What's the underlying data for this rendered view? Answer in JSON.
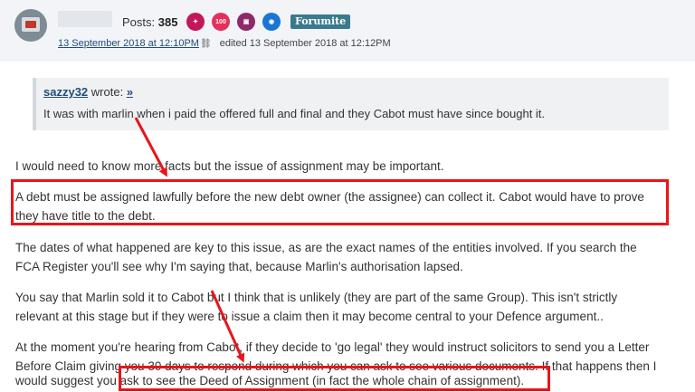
{
  "post": {
    "posts_label": "Posts:",
    "posts_count": "385",
    "badges": [
      "badge-icon",
      "100",
      "badge-icon",
      "camera-icon"
    ],
    "rank": "Forumite",
    "date": "13 September 2018 at 12:10PM",
    "edited": "edited 13 September 2018 at 12:12PM"
  },
  "quote": {
    "author": "sazzy32",
    "wrote": "wrote:",
    "jump": "»",
    "text": "It was with marlin when i paid the offered full and final and they Cabot must have since bought it."
  },
  "body": {
    "p1": "I would need to know more facts but the issue of assignment may be important.",
    "p2_line1": "A debt must be assigned lawfully before the new debt owner (the assignee) can collect it. Cabot would have to prove",
    "p2_line2": "they have title to the debt.",
    "p3_line1": "The dates of what happened are key to this issue, as are the exact names of the entities involved. If you search the",
    "p3_line2": "FCA Register you'll see why I'm saying that, because Marlin's authorisation lapsed.",
    "p4_line1": "You say that Marlin sold it to Cabot but I think that is unlikely (they are part of the same Group). This isn't strictly",
    "p4_line2": "relevant at this stage but if they were to issue a claim then it may become central to your Defence argument..",
    "p5_line1": "At the moment you're hearing from Cabot, if they decide to 'go legal' they would instruct solicitors to send you a Letter",
    "p5_line2": "Before Claim giving you 30 days to respond during which you can ask to see various documents. If that happens then I",
    "p5_line3": "would suggest you ask to see the Deed of Assignment (in fact the whole chain of assignment)."
  },
  "annotation_color": "#e8151b"
}
